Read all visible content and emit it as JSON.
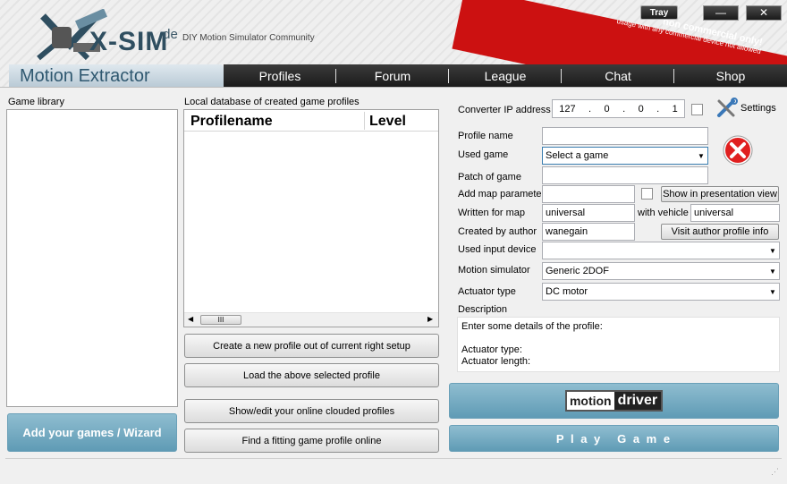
{
  "header": {
    "logo_text": "X-SIM",
    "logo_domain": ".de",
    "tagline": "DIY Motion Simulator Community",
    "app_title": "Motion Extractor",
    "banner_title": "non commercial only!",
    "banner_sub": "usage with any commercial device not allowed",
    "tray_label": "Tray",
    "minimize_glyph": "—",
    "close_glyph": "✕"
  },
  "nav": {
    "tabs": [
      {
        "label": "Profiles"
      },
      {
        "label": "Forum"
      },
      {
        "label": "League"
      },
      {
        "label": "Chat"
      },
      {
        "label": "Shop"
      }
    ]
  },
  "left": {
    "game_library_label": "Game library",
    "add_games_label": "Add your games / Wizard"
  },
  "middle": {
    "db_label": "Local database of created game profiles",
    "col_profilename": "Profilename",
    "col_level": "Level",
    "scroll_thumb": "III",
    "btn_create": "Create a new profile out of current right setup",
    "btn_load": "Load the above selected profile",
    "btn_show_online": "Show/edit your online clouded profiles",
    "btn_find": "Find a fitting game profile online"
  },
  "right": {
    "converter_ip_label": "Converter IP address",
    "ip": [
      "127",
      "0",
      "0",
      "1"
    ],
    "ip_dot": ".",
    "settings_label": "Settings",
    "profile_name_label": "Profile name",
    "profile_name_value": "",
    "used_game_label": "Used game",
    "used_game_value": "Select a game",
    "patch_label": "Patch of game",
    "patch_value": "",
    "add_map_label": "Add map parameter",
    "add_map_value": "",
    "show_presentation_label": "Show in presentation view",
    "written_for_map_label": "Written for map",
    "written_for_map_value": "universal",
    "with_vehicle_label": "with vehicle",
    "with_vehicle_value": "universal",
    "created_by_label": "Created by author",
    "created_by_value": "wanegain",
    "visit_author_label": "Visit author profile info",
    "input_device_label": "Used input device",
    "input_device_value": "",
    "motion_sim_label": "Motion simulator",
    "motion_sim_value": "Generic 2DOF",
    "actuator_type_label": "Actuator type",
    "actuator_type_value": "DC motor",
    "description_label": "Description",
    "description_value": "Enter some details of the profile:\n\nActuator type:\nActuator length:",
    "motion_word": "motion",
    "driver_word": "driver",
    "play_game_label": "P l a y   G a m e"
  },
  "colors": {
    "accent_blue": "#6aa3bb",
    "banner_red": "#cc1111",
    "title_blue": "#2f5870"
  }
}
